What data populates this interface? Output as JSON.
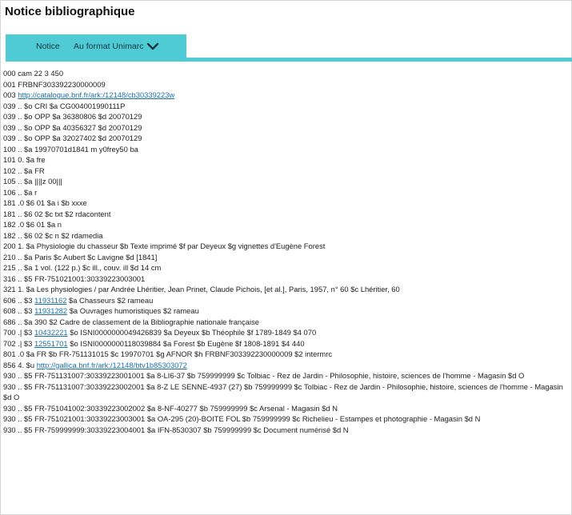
{
  "title": "Notice bibliographique",
  "tabs": {
    "notice_label": "Notice",
    "format_label": "Au format Unimarc"
  },
  "colors": {
    "tab_accent": "#4fcbd6",
    "link": "#1d6fa8",
    "text": "#222222"
  },
  "icons": {
    "format_toggle": "chevron-down-icon"
  },
  "records": [
    {
      "pre": "000 cam 22 3 450"
    },
    {
      "pre": "001 FRBNF303392230000009"
    },
    {
      "pre": "003 ",
      "link": "http://catalogue.bnf.fr/ark:/12148/cb30339223w"
    },
    {
      "pre": "039 .. $o CRI $a CG004001990111P"
    },
    {
      "pre": "039 .. $o OPP $a 36380806 $d 20070129"
    },
    {
      "pre": "039 .. $o OPP $a 40356327 $d 20070129"
    },
    {
      "pre": "039 .. $o OPP $a 32027402 $d 20070129"
    },
    {
      "pre": "100 .. $a 19970701d1841 m y0frey50 ba"
    },
    {
      "pre": "101 0. $a fre"
    },
    {
      "pre": "102 .. $a FR"
    },
    {
      "pre": "105 .. $a ||||z 00|||"
    },
    {
      "pre": "106 .. $a r"
    },
    {
      "pre": "181 .0 $6 01 $a i $b xxxe"
    },
    {
      "pre": "181 .. $6 02 $c txt $2 rdacontent"
    },
    {
      "pre": "182 .0 $6 01 $a n"
    },
    {
      "pre": "182 .. $6 02 $c n $2 rdamedia"
    },
    {
      "pre": "200 1. $a Physiologie du chasseur $b Texte imprimé $f par Deyeux $g vignettes d'Eugène Forest"
    },
    {
      "pre": "210 .. $a Paris $c Aubert $c Lavigne $d [1841]"
    },
    {
      "pre": "215 .. $a 1 vol. (122 p.) $c ill., couv. ill $d 14 cm"
    },
    {
      "pre": "316 .. $5 FR-751021001:30339223003001"
    },
    {
      "pre": "321 1. $a Les physiologies / par Andrée Lhéritier, Jean Prinet, Claude Pichois, [et al.], Paris, 1957, n° 60 $c Lhéritier, 60"
    },
    {
      "pre": "606 .. $3 ",
      "link": "11931162",
      "post": " $a Chasseurs $2 rameau"
    },
    {
      "pre": "608 .. $3 ",
      "link": "11931282",
      "post": " $a Ouvrages humoristiques $2 rameau"
    },
    {
      "pre": "686 .. $a 390 $2 Cadre de classement de la Bibliographie nationale française"
    },
    {
      "pre": "700 .| $3 ",
      "link": "10432221",
      "post": " $o ISNI0000000049426839 $a Deyeux $b Théophile $f 1789-1849 $4 070"
    },
    {
      "pre": "702 .| $3 ",
      "link": "12551701",
      "post": " $o ISNI0000000118039884 $a Forest $b Eugène $f 1808-1891 $4 440"
    },
    {
      "pre": "801 .0 $a FR $b FR-751131015 $c 19970701 $g AFNOR $h FRBNF303392230000009 $2 intermrc"
    },
    {
      "pre": "856 4. $u ",
      "link": "http://gallica.bnf.fr/ark:/12148/btv1b85303072"
    },
    {
      "pre": "930 .. $5 FR-751131007:30339223001001 $a 8-LI6-37 $b 759999999 $c Tolbiac - Rez de Jardin - Philosophie, histoire, sciences de l'homme - Magasin $d O"
    },
    {
      "pre": "930 .. $5 FR-751131007:30339223002001 $a 8-Z LE SENNE-4937 (27) $b 759999999 $c Tolbiac - Rez de Jardin - Philosophie, histoire, sciences de l'homme - Magasin $d O",
      "wrap": true
    },
    {
      "pre": "930 .. $5 FR-751041002:30339223002002 $a 8-NF-40277 $b 759999999 $c Arsenal - Magasin $d N"
    },
    {
      "pre": "930 .. $5 FR-751021001:30339223003001 $a OA-295 (20)-BOITE FOL $b 759999999 $c Richelieu - Estampes et photographie - Magasin $d N"
    },
    {
      "pre": "930 .. $5 FR-759999999:30339223004001 $a IFN-8530307 $b 759999999 $c Document numérisé $d N"
    }
  ]
}
